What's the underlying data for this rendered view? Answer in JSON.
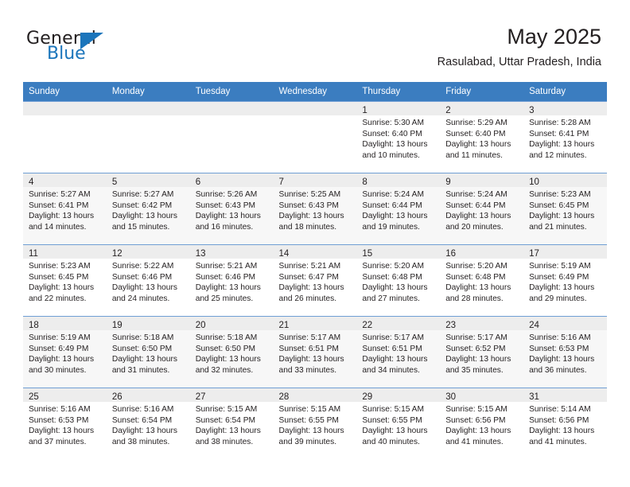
{
  "brand": {
    "word1": "General",
    "word2": "Blue",
    "logo_icon": "blue-triangle-icon"
  },
  "header": {
    "title": "May 2025",
    "location": "Rasulabad, Uttar Pradesh, India"
  },
  "theme": {
    "header_blue": "#3b7dc0",
    "brand_blue": "#1b75bb",
    "row_alt": "#f7f7f7",
    "daynum_bg": "#ededed",
    "text": "#231f20"
  },
  "weekday_headers": [
    "Sunday",
    "Monday",
    "Tuesday",
    "Wednesday",
    "Thursday",
    "Friday",
    "Saturday"
  ],
  "weeks": [
    {
      "alt": false,
      "days": [
        {
          "day": "",
          "empty": true,
          "sunrise": "",
          "sunset": "",
          "daylight_line1": "",
          "daylight_line2": ""
        },
        {
          "day": "",
          "empty": true,
          "sunrise": "",
          "sunset": "",
          "daylight_line1": "",
          "daylight_line2": ""
        },
        {
          "day": "",
          "empty": true,
          "sunrise": "",
          "sunset": "",
          "daylight_line1": "",
          "daylight_line2": ""
        },
        {
          "day": "",
          "empty": true,
          "sunrise": "",
          "sunset": "",
          "daylight_line1": "",
          "daylight_line2": ""
        },
        {
          "day": "1",
          "empty": false,
          "sunrise": "Sunrise: 5:30 AM",
          "sunset": "Sunset: 6:40 PM",
          "daylight_line1": "Daylight: 13 hours",
          "daylight_line2": "and 10 minutes."
        },
        {
          "day": "2",
          "empty": false,
          "sunrise": "Sunrise: 5:29 AM",
          "sunset": "Sunset: 6:40 PM",
          "daylight_line1": "Daylight: 13 hours",
          "daylight_line2": "and 11 minutes."
        },
        {
          "day": "3",
          "empty": false,
          "sunrise": "Sunrise: 5:28 AM",
          "sunset": "Sunset: 6:41 PM",
          "daylight_line1": "Daylight: 13 hours",
          "daylight_line2": "and 12 minutes."
        }
      ]
    },
    {
      "alt": true,
      "days": [
        {
          "day": "4",
          "empty": false,
          "sunrise": "Sunrise: 5:27 AM",
          "sunset": "Sunset: 6:41 PM",
          "daylight_line1": "Daylight: 13 hours",
          "daylight_line2": "and 14 minutes."
        },
        {
          "day": "5",
          "empty": false,
          "sunrise": "Sunrise: 5:27 AM",
          "sunset": "Sunset: 6:42 PM",
          "daylight_line1": "Daylight: 13 hours",
          "daylight_line2": "and 15 minutes."
        },
        {
          "day": "6",
          "empty": false,
          "sunrise": "Sunrise: 5:26 AM",
          "sunset": "Sunset: 6:43 PM",
          "daylight_line1": "Daylight: 13 hours",
          "daylight_line2": "and 16 minutes."
        },
        {
          "day": "7",
          "empty": false,
          "sunrise": "Sunrise: 5:25 AM",
          "sunset": "Sunset: 6:43 PM",
          "daylight_line1": "Daylight: 13 hours",
          "daylight_line2": "and 18 minutes."
        },
        {
          "day": "8",
          "empty": false,
          "sunrise": "Sunrise: 5:24 AM",
          "sunset": "Sunset: 6:44 PM",
          "daylight_line1": "Daylight: 13 hours",
          "daylight_line2": "and 19 minutes."
        },
        {
          "day": "9",
          "empty": false,
          "sunrise": "Sunrise: 5:24 AM",
          "sunset": "Sunset: 6:44 PM",
          "daylight_line1": "Daylight: 13 hours",
          "daylight_line2": "and 20 minutes."
        },
        {
          "day": "10",
          "empty": false,
          "sunrise": "Sunrise: 5:23 AM",
          "sunset": "Sunset: 6:45 PM",
          "daylight_line1": "Daylight: 13 hours",
          "daylight_line2": "and 21 minutes."
        }
      ]
    },
    {
      "alt": false,
      "days": [
        {
          "day": "11",
          "empty": false,
          "sunrise": "Sunrise: 5:23 AM",
          "sunset": "Sunset: 6:45 PM",
          "daylight_line1": "Daylight: 13 hours",
          "daylight_line2": "and 22 minutes."
        },
        {
          "day": "12",
          "empty": false,
          "sunrise": "Sunrise: 5:22 AM",
          "sunset": "Sunset: 6:46 PM",
          "daylight_line1": "Daylight: 13 hours",
          "daylight_line2": "and 24 minutes."
        },
        {
          "day": "13",
          "empty": false,
          "sunrise": "Sunrise: 5:21 AM",
          "sunset": "Sunset: 6:46 PM",
          "daylight_line1": "Daylight: 13 hours",
          "daylight_line2": "and 25 minutes."
        },
        {
          "day": "14",
          "empty": false,
          "sunrise": "Sunrise: 5:21 AM",
          "sunset": "Sunset: 6:47 PM",
          "daylight_line1": "Daylight: 13 hours",
          "daylight_line2": "and 26 minutes."
        },
        {
          "day": "15",
          "empty": false,
          "sunrise": "Sunrise: 5:20 AM",
          "sunset": "Sunset: 6:48 PM",
          "daylight_line1": "Daylight: 13 hours",
          "daylight_line2": "and 27 minutes."
        },
        {
          "day": "16",
          "empty": false,
          "sunrise": "Sunrise: 5:20 AM",
          "sunset": "Sunset: 6:48 PM",
          "daylight_line1": "Daylight: 13 hours",
          "daylight_line2": "and 28 minutes."
        },
        {
          "day": "17",
          "empty": false,
          "sunrise": "Sunrise: 5:19 AM",
          "sunset": "Sunset: 6:49 PM",
          "daylight_line1": "Daylight: 13 hours",
          "daylight_line2": "and 29 minutes."
        }
      ]
    },
    {
      "alt": true,
      "days": [
        {
          "day": "18",
          "empty": false,
          "sunrise": "Sunrise: 5:19 AM",
          "sunset": "Sunset: 6:49 PM",
          "daylight_line1": "Daylight: 13 hours",
          "daylight_line2": "and 30 minutes."
        },
        {
          "day": "19",
          "empty": false,
          "sunrise": "Sunrise: 5:18 AM",
          "sunset": "Sunset: 6:50 PM",
          "daylight_line1": "Daylight: 13 hours",
          "daylight_line2": "and 31 minutes."
        },
        {
          "day": "20",
          "empty": false,
          "sunrise": "Sunrise: 5:18 AM",
          "sunset": "Sunset: 6:50 PM",
          "daylight_line1": "Daylight: 13 hours",
          "daylight_line2": "and 32 minutes."
        },
        {
          "day": "21",
          "empty": false,
          "sunrise": "Sunrise: 5:17 AM",
          "sunset": "Sunset: 6:51 PM",
          "daylight_line1": "Daylight: 13 hours",
          "daylight_line2": "and 33 minutes."
        },
        {
          "day": "22",
          "empty": false,
          "sunrise": "Sunrise: 5:17 AM",
          "sunset": "Sunset: 6:51 PM",
          "daylight_line1": "Daylight: 13 hours",
          "daylight_line2": "and 34 minutes."
        },
        {
          "day": "23",
          "empty": false,
          "sunrise": "Sunrise: 5:17 AM",
          "sunset": "Sunset: 6:52 PM",
          "daylight_line1": "Daylight: 13 hours",
          "daylight_line2": "and 35 minutes."
        },
        {
          "day": "24",
          "empty": false,
          "sunrise": "Sunrise: 5:16 AM",
          "sunset": "Sunset: 6:53 PM",
          "daylight_line1": "Daylight: 13 hours",
          "daylight_line2": "and 36 minutes."
        }
      ]
    },
    {
      "alt": false,
      "days": [
        {
          "day": "25",
          "empty": false,
          "sunrise": "Sunrise: 5:16 AM",
          "sunset": "Sunset: 6:53 PM",
          "daylight_line1": "Daylight: 13 hours",
          "daylight_line2": "and 37 minutes."
        },
        {
          "day": "26",
          "empty": false,
          "sunrise": "Sunrise: 5:16 AM",
          "sunset": "Sunset: 6:54 PM",
          "daylight_line1": "Daylight: 13 hours",
          "daylight_line2": "and 38 minutes."
        },
        {
          "day": "27",
          "empty": false,
          "sunrise": "Sunrise: 5:15 AM",
          "sunset": "Sunset: 6:54 PM",
          "daylight_line1": "Daylight: 13 hours",
          "daylight_line2": "and 38 minutes."
        },
        {
          "day": "28",
          "empty": false,
          "sunrise": "Sunrise: 5:15 AM",
          "sunset": "Sunset: 6:55 PM",
          "daylight_line1": "Daylight: 13 hours",
          "daylight_line2": "and 39 minutes."
        },
        {
          "day": "29",
          "empty": false,
          "sunrise": "Sunrise: 5:15 AM",
          "sunset": "Sunset: 6:55 PM",
          "daylight_line1": "Daylight: 13 hours",
          "daylight_line2": "and 40 minutes."
        },
        {
          "day": "30",
          "empty": false,
          "sunrise": "Sunrise: 5:15 AM",
          "sunset": "Sunset: 6:56 PM",
          "daylight_line1": "Daylight: 13 hours",
          "daylight_line2": "and 41 minutes."
        },
        {
          "day": "31",
          "empty": false,
          "sunrise": "Sunrise: 5:14 AM",
          "sunset": "Sunset: 6:56 PM",
          "daylight_line1": "Daylight: 13 hours",
          "daylight_line2": "and 41 minutes."
        }
      ]
    }
  ]
}
